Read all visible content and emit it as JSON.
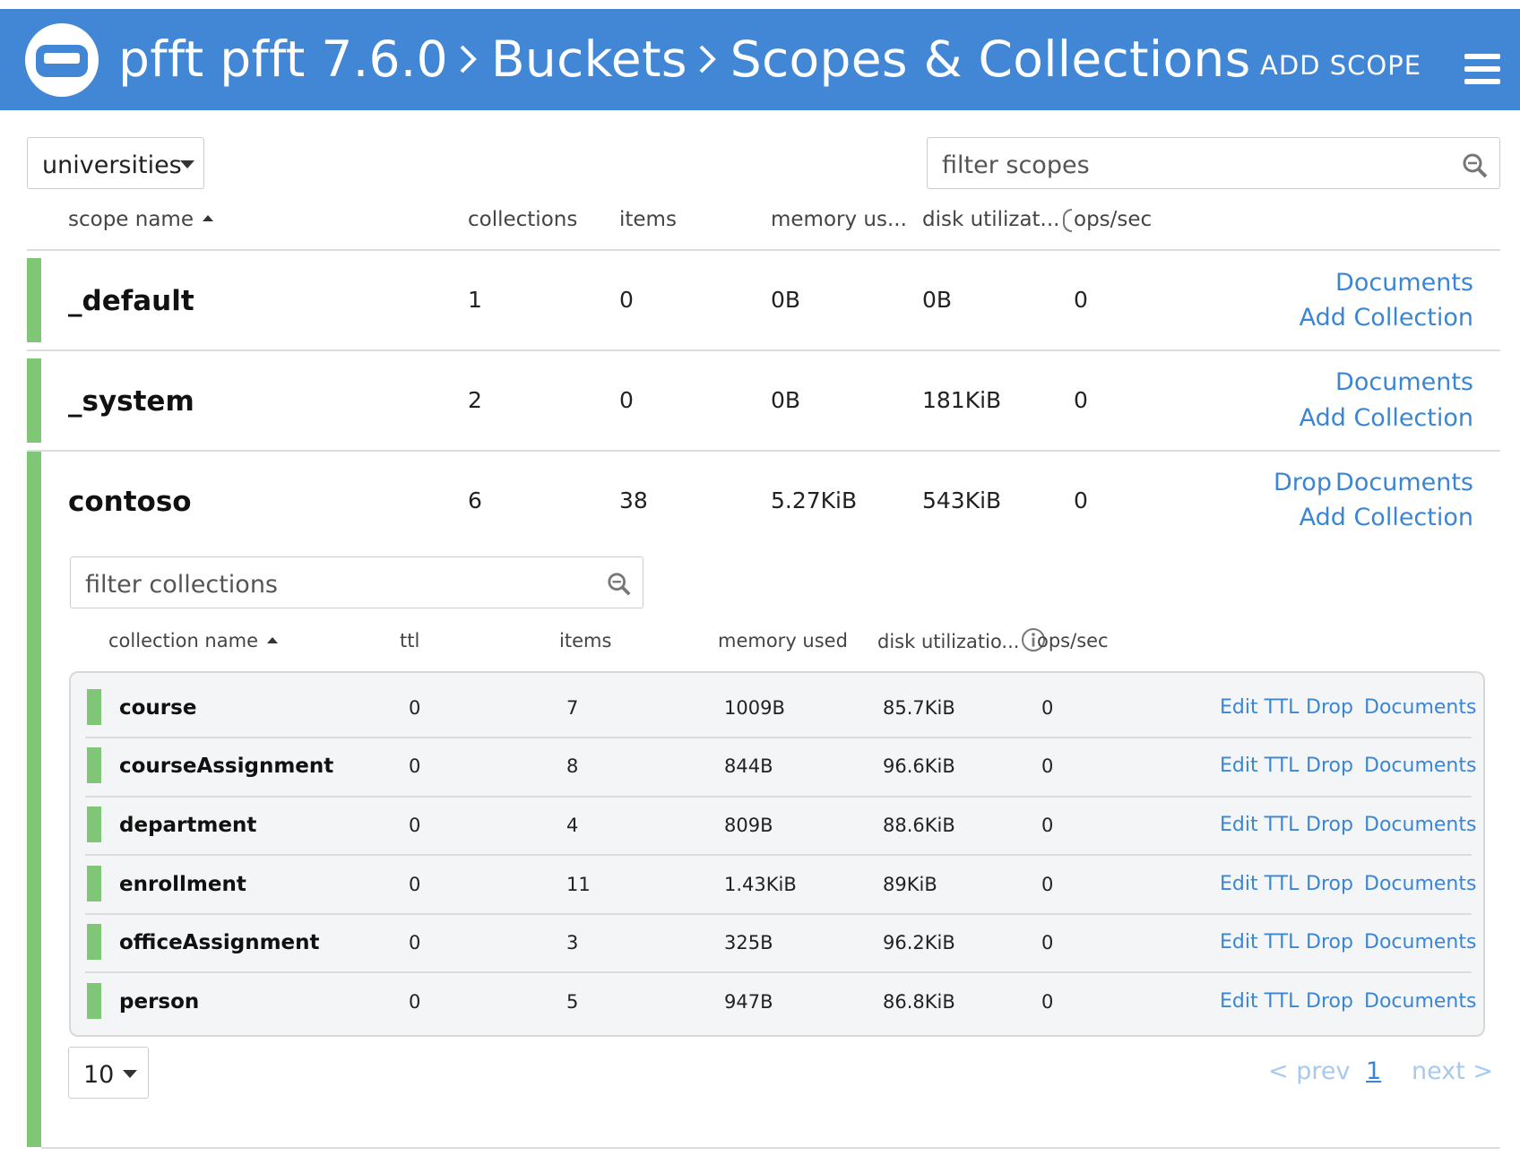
{
  "header": {
    "breadcrumb": [
      "pfft pfft 7.6.0",
      "Buckets",
      "Scopes & Collections"
    ],
    "add_scope_label": "ADD SCOPE"
  },
  "bucket_select": {
    "value": "universities"
  },
  "scope_filter": {
    "placeholder": "filter scopes"
  },
  "scope_columns": [
    "scope name",
    "collections",
    "items",
    "memory us...",
    "disk utilizat...",
    "ops/sec"
  ],
  "scopes": [
    {
      "name": "_default",
      "collections": "1",
      "items": "0",
      "memory": "0B",
      "disk": "0B",
      "ops": "0",
      "actions": [
        "Documents",
        "Add Collection"
      ]
    },
    {
      "name": "_system",
      "collections": "2",
      "items": "0",
      "memory": "0B",
      "disk": "181KiB",
      "ops": "0",
      "actions": [
        "Documents",
        "Add Collection"
      ]
    },
    {
      "name": "contoso",
      "collections": "6",
      "items": "38",
      "memory": "5.27KiB",
      "disk": "543KiB",
      "ops": "0",
      "actions": [
        "Drop",
        "Documents",
        "Add Collection"
      ]
    }
  ],
  "collection_filter": {
    "placeholder": "filter collections"
  },
  "collection_columns": [
    "collection name",
    "ttl",
    "items",
    "memory used",
    "disk utilizatio...",
    "ops/sec"
  ],
  "collections": [
    {
      "name": "course",
      "ttl": "0",
      "items": "7",
      "memory": "1009B",
      "disk": "85.7KiB",
      "ops": "0"
    },
    {
      "name": "courseAssignment",
      "ttl": "0",
      "items": "8",
      "memory": "844B",
      "disk": "96.6KiB",
      "ops": "0"
    },
    {
      "name": "department",
      "ttl": "0",
      "items": "4",
      "memory": "809B",
      "disk": "88.6KiB",
      "ops": "0"
    },
    {
      "name": "enrollment",
      "ttl": "0",
      "items": "11",
      "memory": "1.43KiB",
      "disk": "89KiB",
      "ops": "0"
    },
    {
      "name": "officeAssignment",
      "ttl": "0",
      "items": "3",
      "memory": "325B",
      "disk": "96.2KiB",
      "ops": "0"
    },
    {
      "name": "person",
      "ttl": "0",
      "items": "5",
      "memory": "947B",
      "disk": "86.8KiB",
      "ops": "0"
    }
  ],
  "collection_actions": [
    "Edit TTL",
    "Drop",
    "Documents"
  ],
  "pagination": {
    "page_size": "10",
    "prev": "< prev",
    "current": "1",
    "next": "next >"
  },
  "colors": {
    "header": "#4287d6",
    "link": "#3a86d4",
    "status_green": "#7fc776"
  }
}
